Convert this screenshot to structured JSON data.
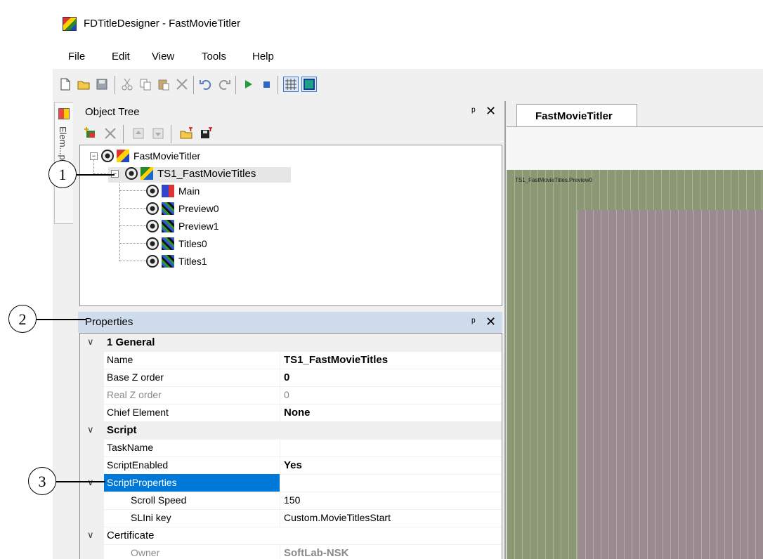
{
  "window": {
    "title": "FDTitleDesigner - FastMovieTitler"
  },
  "menu": [
    "File",
    "Edit",
    "View",
    "Tools",
    "Help"
  ],
  "sidetab": {
    "label": "Elem...pes"
  },
  "object_tree": {
    "title": "Object Tree",
    "pin": "▕",
    "close": "✕",
    "nodes": [
      {
        "label": "FastMovieTitler"
      },
      {
        "label": "TS1_FastMovieTitles"
      },
      {
        "label": "Main"
      },
      {
        "label": "Preview0"
      },
      {
        "label": "Preview1"
      },
      {
        "label": "Titles0"
      },
      {
        "label": "Titles1"
      }
    ]
  },
  "properties": {
    "title": "Properties",
    "categories": {
      "general": "1 General",
      "script": "Script",
      "certificate": "Certificate"
    },
    "rows": {
      "name": {
        "name": "Name",
        "value": "TS1_FastMovieTitles"
      },
      "base_z": {
        "name": "Base Z order",
        "value": "0"
      },
      "real_z": {
        "name": "Real Z order",
        "value": "0"
      },
      "chief": {
        "name": "Chief Element",
        "value": "None"
      },
      "taskname": {
        "name": "TaskName",
        "value": ""
      },
      "script_enabled": {
        "name": "ScriptEnabled",
        "value": "Yes"
      },
      "script_props": {
        "name": "ScriptProperties",
        "value": ""
      },
      "scroll_speed": {
        "name": "Scroll Speed",
        "value": "150"
      },
      "slini": {
        "name": "SLIni key",
        "value": "Custom.MovieTitlesStart"
      },
      "owner": {
        "name": "Owner",
        "value": "SoftLab-NSK"
      }
    }
  },
  "document": {
    "tab": "FastMovieTitler",
    "canvas_label": "TS1_FastMovieTitles.Preview0"
  },
  "callouts": [
    "1",
    "2",
    "3"
  ],
  "colors": {
    "selection": "#0078d7",
    "properties_header": "#cfdcec",
    "canvas_outer": "#8c9773",
    "canvas_inner": "#9a8b90"
  }
}
